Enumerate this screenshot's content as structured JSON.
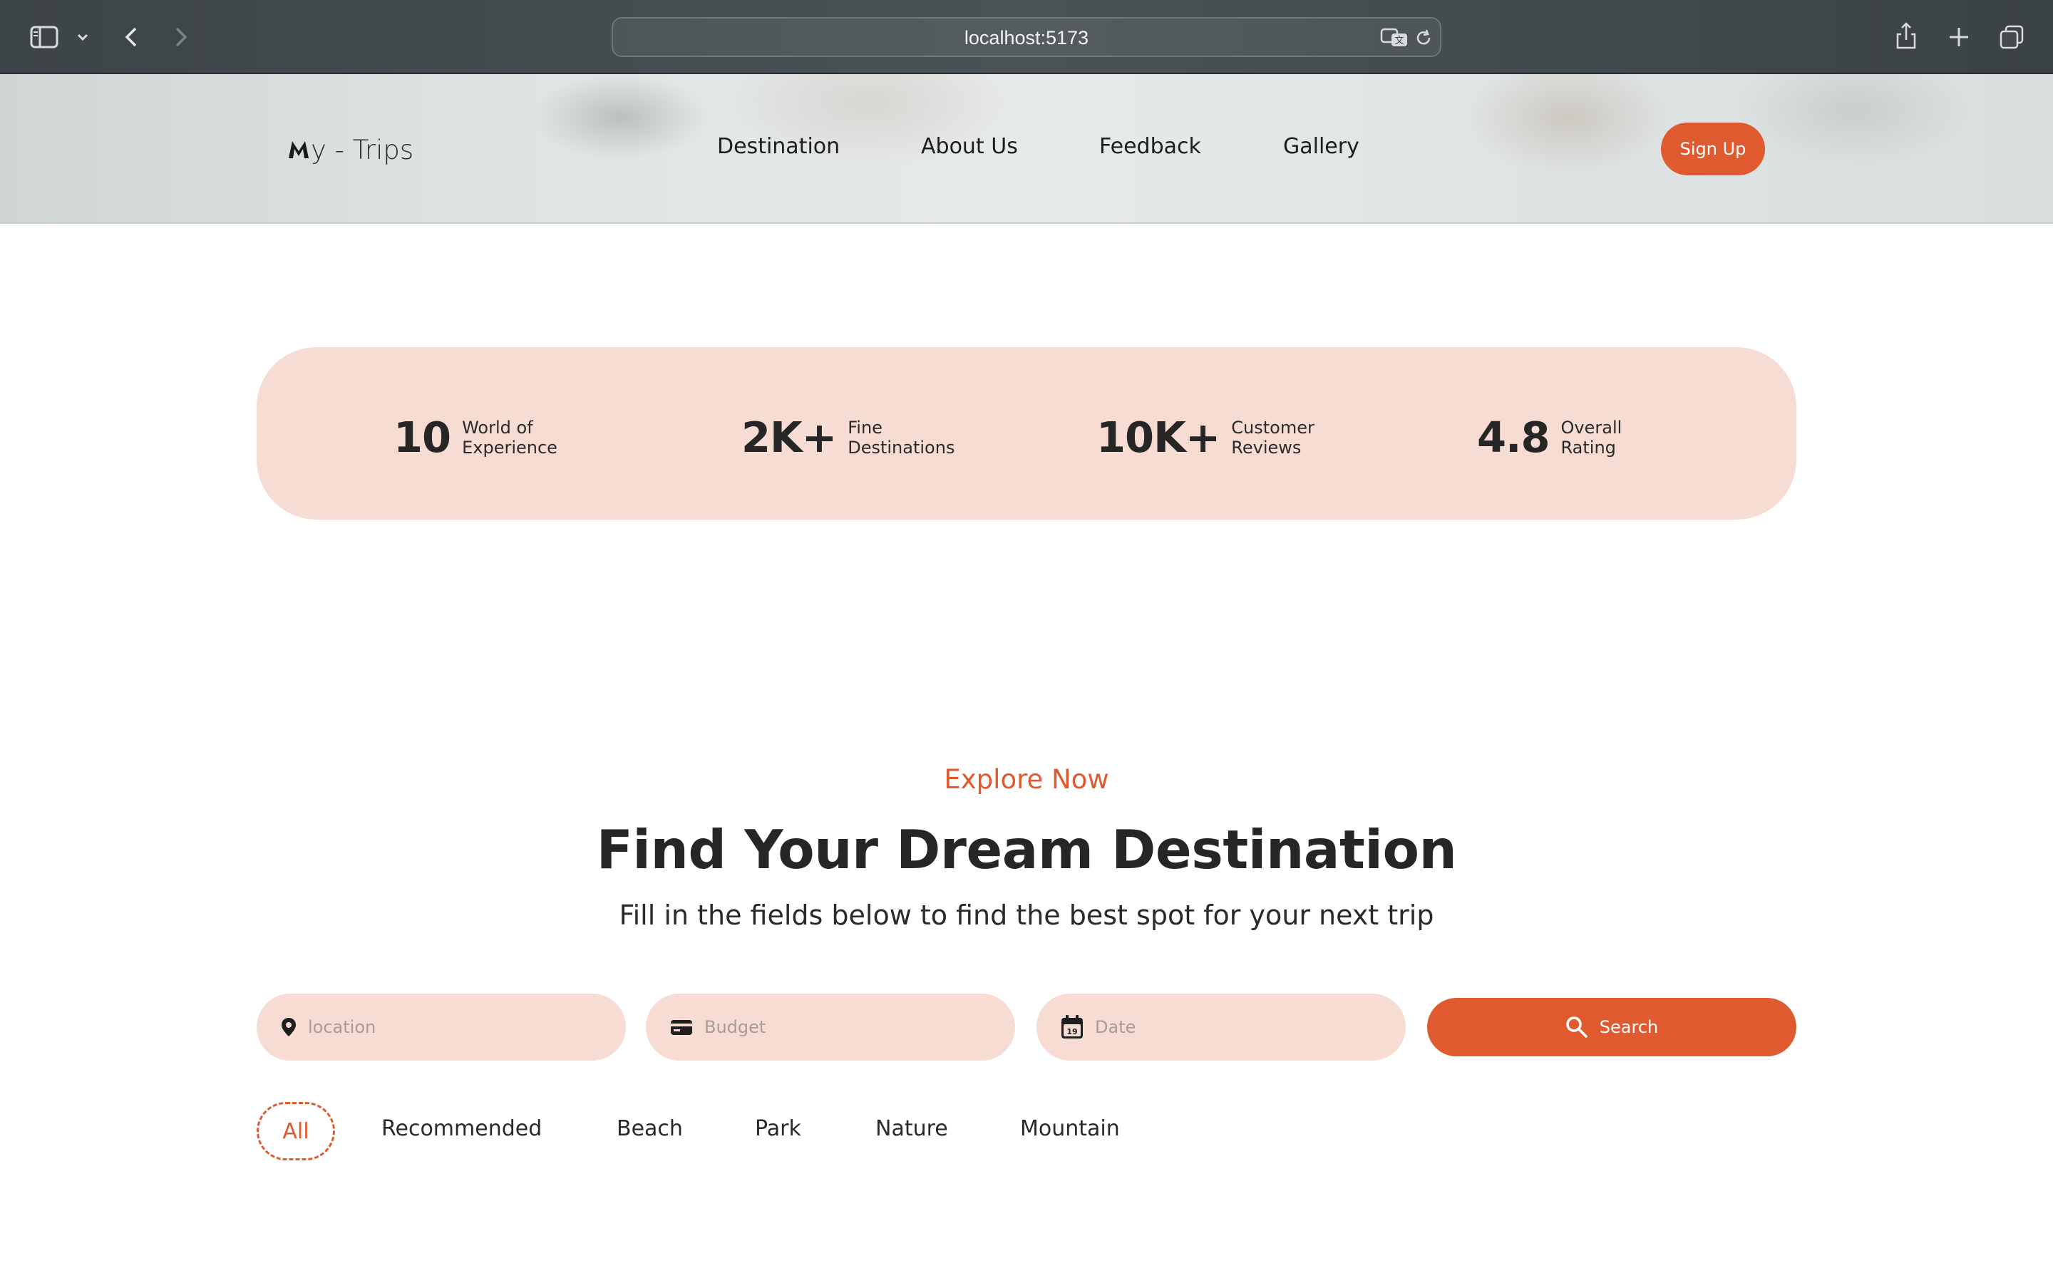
{
  "browser": {
    "url": "localhost:5173"
  },
  "header": {
    "logo_text": "y - Trips",
    "nav": [
      "Destination",
      "About Us",
      "Feedback",
      "Gallery"
    ],
    "signup_label": "Sign Up"
  },
  "stats": [
    {
      "value": "10",
      "label_line1": "World of",
      "label_line2": "Experience"
    },
    {
      "value": "2K+",
      "label_line1": "Fine",
      "label_line2": "Destinations"
    },
    {
      "value": "10K+",
      "label_line1": "Customer",
      "label_line2": "Reviews"
    },
    {
      "value": "4.8",
      "label_line1": "Overall",
      "label_line2": "Rating"
    }
  ],
  "explore": {
    "eyebrow": "Explore Now",
    "title": "Find Your Dream Destination",
    "subtitle": "Fill in the fields below to find the best spot for your next trip"
  },
  "search": {
    "location_placeholder": "location",
    "budget_placeholder": "Budget",
    "date_placeholder": "Date",
    "calendar_day": "19",
    "button_label": "Search"
  },
  "filters": [
    "All",
    "Recommended",
    "Beach",
    "Park",
    "Nature",
    "Mountain"
  ],
  "colors": {
    "accent": "#e05a2f",
    "soft": "#f7dcd4"
  },
  "icons": [
    "sidebar-icon",
    "chevron-down-icon",
    "back-icon",
    "forward-icon",
    "translate-icon",
    "reload-icon",
    "share-icon",
    "new-tab-icon",
    "tabs-overview-icon",
    "location-pin-icon",
    "wallet-icon",
    "calendar-icon",
    "search-icon"
  ]
}
